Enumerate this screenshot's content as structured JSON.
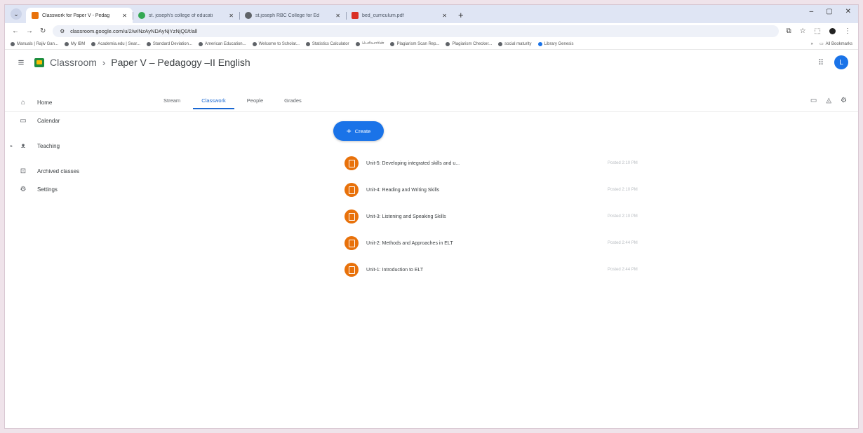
{
  "browser": {
    "tabs": [
      {
        "title": "Classwork for Paper V - Pedag",
        "color": "#e8710a",
        "active": true
      },
      {
        "title": "st. joseph's college of educati",
        "color": "#34a853",
        "active": false
      },
      {
        "title": "st.joseph RBC College for Ed",
        "color": "#5f6368",
        "active": false
      },
      {
        "title": "bed_curriculum.pdf",
        "color": "#d93025",
        "active": false
      }
    ],
    "window_controls": [
      "–",
      "▢",
      "✕"
    ],
    "url": "classroom.google.com/u/2/w/NzAyNDAyNjYzNjQ0/t/all",
    "bookmarks": [
      "Manuals | Rajiv Gan...",
      "My IBM",
      "Academia.edu | Sear...",
      "Standard Deviation...",
      "American Education...",
      "Welcome to Scholar...",
      "Statistics Calculator",
      "பெரியாரின்",
      "Plagiarism Scan Rep...",
      "Plagiarism Checker...",
      "social maturity",
      "Library Genesis"
    ],
    "all_bookmarks": "All Bookmarks"
  },
  "header": {
    "app_name": "Classroom",
    "separator": "›",
    "course_title": "Paper V – Pedagogy –II English",
    "avatar_letter": "L"
  },
  "sidebar": {
    "items": [
      {
        "label": "Home",
        "icon": "home-icon"
      },
      {
        "label": "Calendar",
        "icon": "calendar-icon"
      },
      {
        "label": "Teaching",
        "icon": "people-icon"
      },
      {
        "label": "Archived classes",
        "icon": "archive-icon"
      },
      {
        "label": "Settings",
        "icon": "gear-icon"
      }
    ]
  },
  "tabs": [
    {
      "label": "Stream",
      "active": false
    },
    {
      "label": "Classwork",
      "active": true
    },
    {
      "label": "People",
      "active": false
    },
    {
      "label": "Grades",
      "active": false
    }
  ],
  "create_label": "Create",
  "topics": [
    {
      "title": "Unit-5: Developing integrated skills and u...",
      "posted": "Posted 2:10 PM"
    },
    {
      "title": "Unit-4: Reading and Writing Skills",
      "posted": "Posted 2:10 PM"
    },
    {
      "title": "Unit-3: Listening and Speaking Skills",
      "posted": "Posted 2:10 PM"
    },
    {
      "title": "Unit-2: Methods and Approaches in ELT",
      "posted": "Posted 2:44 PM"
    },
    {
      "title": "Unit-1: Introduction to ELT",
      "posted": "Posted 2:44 PM"
    }
  ],
  "colors": {
    "accent": "#1a73e8",
    "topic_icon": "#e8710a",
    "brand_green": "#1e8e3e"
  }
}
